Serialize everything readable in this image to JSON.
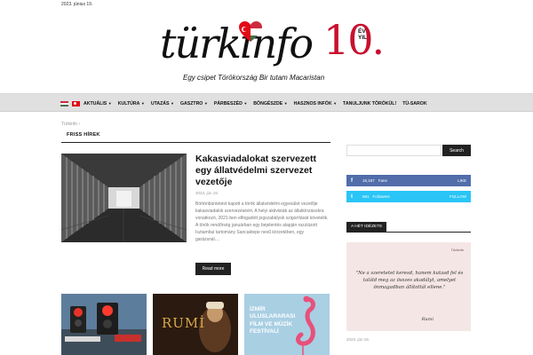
{
  "topbar": {
    "date": "2023. június 19."
  },
  "logo": {
    "word": "türkinfo",
    "ten": "10.",
    "ev": "ÉV",
    "yil": "YIL",
    "tagline": "Egy csipet Törökország  Bir tutam Macaristan"
  },
  "nav": {
    "items": [
      {
        "label": "AKTUÁLIS",
        "caret": true
      },
      {
        "label": "KULTÚRA",
        "caret": true
      },
      {
        "label": "UTAZÁS",
        "caret": true
      },
      {
        "label": "GASZTRO",
        "caret": true
      },
      {
        "label": "PÁRBESZÉD",
        "caret": true
      },
      {
        "label": "BÖNGÉSZDE",
        "caret": true
      },
      {
        "label": "HASZNOS INFÓK",
        "caret": true
      },
      {
        "label": "TANULJUNK TÖRÖKÜL!",
        "caret": false
      },
      {
        "label": "TÜ-SAROK",
        "caret": false
      }
    ]
  },
  "breadcrumb": {
    "home": "Türkinfo",
    "sep": "›"
  },
  "section": {
    "title": "FRISS HÍREK"
  },
  "featured": {
    "title": "Kakasviadalokat szervezett egy állatvédelmi szervezet vezetője",
    "date": "2023. jún 19.",
    "excerpt": "Börtönbüntetést kapott a török állatvédelmi egyesület vezetője kakasviadalok szervezéséért. A helyi aktivisták az állatkínzásokra vonatkozó, 2021-ben elfogadott jogszabályok szigorítását követelik. A török rendőrség januárban egy bejelentés alapján razziázott Isztambul tartomány Sancaktepe nevű körzetében, egy garázsnál....",
    "read_more": "Read more"
  },
  "thumbs": [
    {
      "text": ""
    },
    {
      "text": "RUMİ"
    },
    {
      "text": "İZMİR ULUSLARARASI FİLM VE MÜZİK FESTİVALİ"
    }
  ],
  "search": {
    "placeholder": "",
    "button": "Search"
  },
  "social": {
    "facebook": {
      "count": "15,187",
      "label": "Fans",
      "action": "LIKE",
      "color": "#516eab"
    },
    "twitter": {
      "count": "561",
      "label": "Followers",
      "action": "FOLLOW",
      "color": "#29c5f6"
    }
  },
  "quote": {
    "heading": "A HÉT IDÉZETE",
    "brand": "Türkinfo",
    "text": "\"Ne a szeretetet keresd, hanem kutasd fel és találd meg az összes akadályt, amelyet önmagadban állítottál ellene.\"",
    "author": "Rumi",
    "date": "2023. jún 19."
  }
}
